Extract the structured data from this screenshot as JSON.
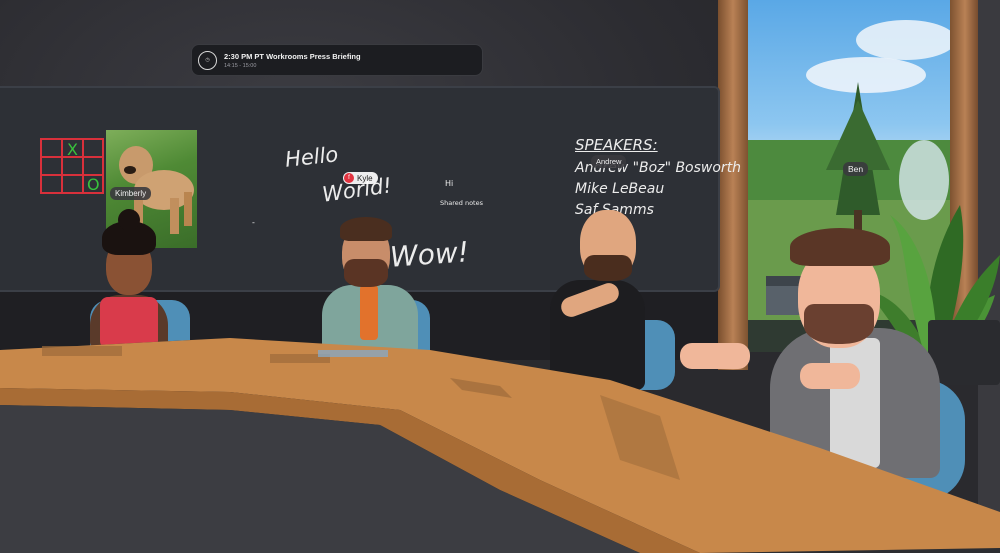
{
  "banner": {
    "title": "2:30 PM PT Workrooms Press Briefing",
    "time": "14:15 - 15:00",
    "icon": "clock-icon"
  },
  "whiteboard": {
    "hello": "Hello",
    "world": "World!",
    "hi": "Hi",
    "shared_notes": "Shared notes",
    "wow": "Wow!",
    "tic_tac_toe": [
      "X",
      "O"
    ],
    "speakers": {
      "heading": "SPEAKERS:",
      "names": [
        "Andrew \"Boz\" Bosworth",
        "Mike LeBeau",
        "Saf Samms"
      ]
    }
  },
  "cursor": {
    "initial": "f",
    "name": "Kyle"
  },
  "nametags": {
    "kimberly": "Kimberly",
    "andrew": "Andrew",
    "ben": "Ben"
  },
  "colors": {
    "whiteboard": "#2d3036",
    "table": "#c8884a",
    "chair": "#4f8fb7",
    "ttt_grid": "#d8303b",
    "ttt_marks": "#38c23c",
    "cursor_accent": "#e23340"
  }
}
